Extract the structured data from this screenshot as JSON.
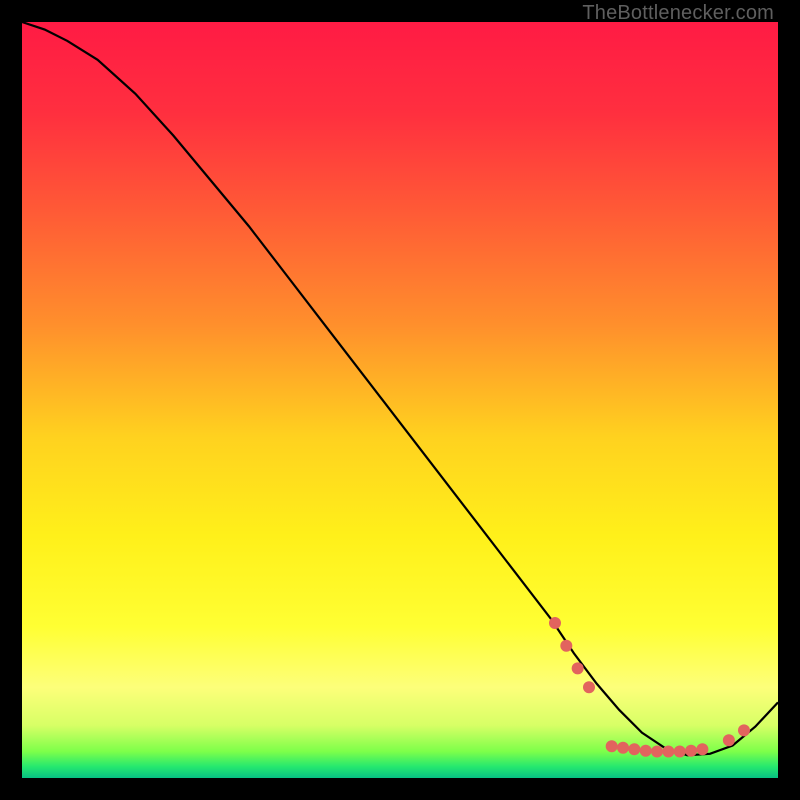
{
  "watermark": "TheBottlenecker.com",
  "chart_data": {
    "type": "line",
    "title": "",
    "xlabel": "",
    "ylabel": "",
    "xlim": [
      0,
      100
    ],
    "ylim": [
      0,
      100
    ],
    "grid": false,
    "background_gradient": {
      "stops": [
        {
          "offset": 0.0,
          "color": "#ff1b44"
        },
        {
          "offset": 0.12,
          "color": "#ff2f3f"
        },
        {
          "offset": 0.25,
          "color": "#ff5a36"
        },
        {
          "offset": 0.4,
          "color": "#ff8f2c"
        },
        {
          "offset": 0.55,
          "color": "#ffd21f"
        },
        {
          "offset": 0.68,
          "color": "#fff01a"
        },
        {
          "offset": 0.8,
          "color": "#ffff33"
        },
        {
          "offset": 0.88,
          "color": "#fdff7a"
        },
        {
          "offset": 0.93,
          "color": "#d8ff66"
        },
        {
          "offset": 0.965,
          "color": "#7dff4a"
        },
        {
          "offset": 0.985,
          "color": "#25e86f"
        },
        {
          "offset": 1.0,
          "color": "#07c183"
        }
      ]
    },
    "series": [
      {
        "name": "curve",
        "stroke": "#000000",
        "x": [
          0,
          3,
          6,
          10,
          15,
          20,
          25,
          30,
          35,
          40,
          45,
          50,
          55,
          60,
          65,
          70,
          73,
          76,
          79,
          82,
          85,
          88,
          91,
          94,
          97,
          100
        ],
        "y": [
          100,
          99,
          97.5,
          95,
          90.5,
          85,
          79,
          73,
          66.5,
          60,
          53.5,
          47,
          40.5,
          34,
          27.5,
          21,
          16.5,
          12.5,
          9,
          6,
          4,
          3,
          3.2,
          4.3,
          6.8,
          10
        ]
      }
    ],
    "markers": {
      "color": "#e2645e",
      "radius": 6,
      "points": [
        {
          "x": 70.5,
          "y": 20.5
        },
        {
          "x": 72.0,
          "y": 17.5
        },
        {
          "x": 73.5,
          "y": 14.5
        },
        {
          "x": 75.0,
          "y": 12.0
        },
        {
          "x": 78.0,
          "y": 4.2
        },
        {
          "x": 79.5,
          "y": 4.0
        },
        {
          "x": 81.0,
          "y": 3.8
        },
        {
          "x": 82.5,
          "y": 3.6
        },
        {
          "x": 84.0,
          "y": 3.5
        },
        {
          "x": 85.5,
          "y": 3.5
        },
        {
          "x": 87.0,
          "y": 3.5
        },
        {
          "x": 88.5,
          "y": 3.6
        },
        {
          "x": 90.0,
          "y": 3.8
        },
        {
          "x": 93.5,
          "y": 5.0
        },
        {
          "x": 95.5,
          "y": 6.3
        }
      ]
    }
  }
}
